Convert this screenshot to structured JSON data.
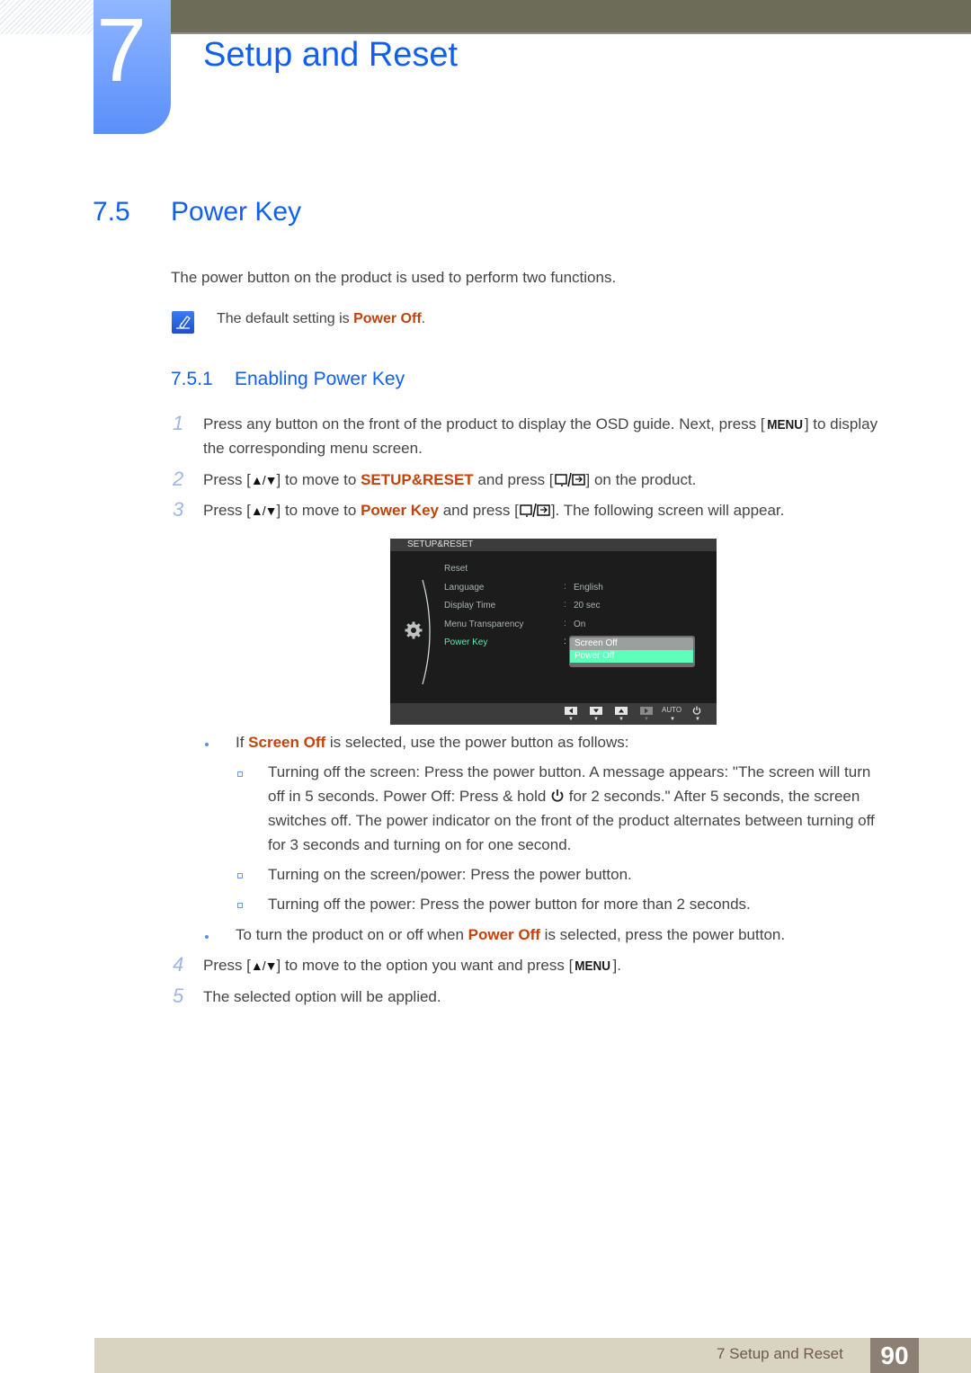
{
  "chapter": {
    "number": "7",
    "title": "Setup and Reset"
  },
  "section": {
    "number": "7.5",
    "title": "Power Key"
  },
  "intro_text": "The power button on the product is used to perform two functions.",
  "note": {
    "icon": "note-pencil-icon",
    "prefix": "The default setting is ",
    "highlight": "Power Off",
    "suffix": "."
  },
  "subsection": {
    "number": "7.5.1",
    "title": "Enabling Power Key"
  },
  "steps": [
    {
      "num": "1",
      "line1_a": "Press any button on the front of the product to display the OSD guide. Next, press [",
      "key": "MENU",
      "line1_b": "] to display",
      "line2": "the corresponding menu screen."
    },
    {
      "num": "2",
      "a": "Press [",
      "b": "] to move to ",
      "highlight": "SETUP&RESET",
      "c": " and press [",
      "d": "] on the product."
    },
    {
      "num": "3",
      "a": "Press [",
      "b": "] to move to ",
      "highlight": "Power Key",
      "c": " and press [",
      "d": "]. The following screen will appear."
    },
    {
      "num": "4",
      "a": "Press [",
      "b": "] to move to the option you want and press [",
      "key": "MENU",
      "c": "]."
    },
    {
      "num": "5",
      "text": "The selected option will be applied."
    }
  ],
  "keys": {
    "up_down": "▲/▼"
  },
  "osd": {
    "title": "SETUP&RESET",
    "items": [
      {
        "label": "Reset",
        "value": ""
      },
      {
        "label": "Language",
        "value": "English"
      },
      {
        "label": "Display Time",
        "value": "20 sec"
      },
      {
        "label": "Menu Transparency",
        "value": "On"
      },
      {
        "label": "Power Key",
        "value": ""
      }
    ],
    "colon": ":",
    "options": [
      "Screen Off",
      "Power Off"
    ],
    "selected_option": "Power Off",
    "footer_buttons": [
      "left-icon",
      "down-icon",
      "up-icon",
      "right-icon",
      "AUTO",
      "power-icon"
    ],
    "auto_label": "AUTO"
  },
  "bullets": [
    {
      "a": "If ",
      "highlight": "Screen Off",
      "b": " is selected, use the power button as follows:",
      "sub": [
        {
          "lines": [
            "Turning off the screen: Press the power button. A message appears: \"The screen will turn",
            "off in 5 seconds. Power Off: Press & hold ",
            " for 2 seconds.\" After 5 seconds, the screen",
            "switches off. The power indicator on the front of the product alternates between turning off",
            "for 3 seconds and turning on for one second."
          ]
        },
        {
          "text": "Turning on the screen/power: Press the power button."
        },
        {
          "text": "Turning off the power: Press the power button for more than 2 seconds."
        }
      ]
    },
    {
      "a": "To turn the product on or off when ",
      "highlight": "Power Off",
      "b": " is selected, press the power button."
    }
  ],
  "footer": {
    "label": "7 Setup and Reset",
    "page": "90"
  }
}
